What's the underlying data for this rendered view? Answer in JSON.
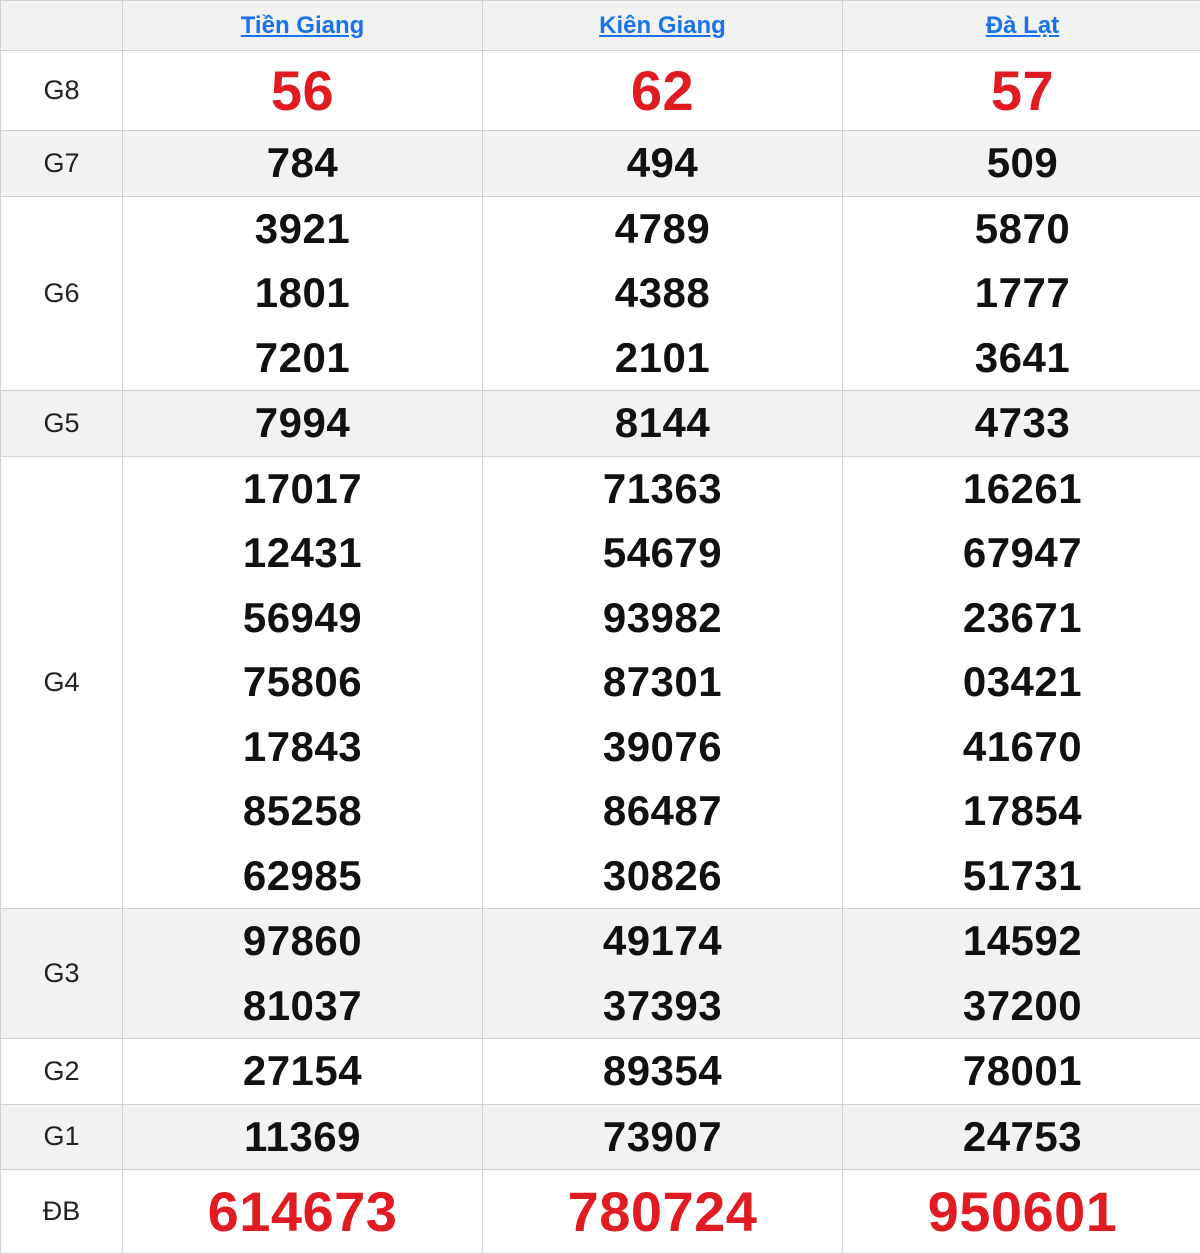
{
  "columns": [
    "Tiền Giang",
    "Kiên Giang",
    "Đà Lạt"
  ],
  "prizes": [
    {
      "label": "G8",
      "values": [
        [
          "56"
        ],
        [
          "62"
        ],
        [
          "57"
        ]
      ]
    },
    {
      "label": "G7",
      "values": [
        [
          "784"
        ],
        [
          "494"
        ],
        [
          "509"
        ]
      ]
    },
    {
      "label": "G6",
      "values": [
        [
          "3921",
          "1801",
          "7201"
        ],
        [
          "4789",
          "4388",
          "2101"
        ],
        [
          "5870",
          "1777",
          "3641"
        ]
      ]
    },
    {
      "label": "G5",
      "values": [
        [
          "7994"
        ],
        [
          "8144"
        ],
        [
          "4733"
        ]
      ]
    },
    {
      "label": "G4",
      "values": [
        [
          "17017",
          "12431",
          "56949",
          "75806",
          "17843",
          "85258",
          "62985"
        ],
        [
          "71363",
          "54679",
          "93982",
          "87301",
          "39076",
          "86487",
          "30826"
        ],
        [
          "16261",
          "67947",
          "23671",
          "03421",
          "41670",
          "17854",
          "51731"
        ]
      ]
    },
    {
      "label": "G3",
      "values": [
        [
          "97860",
          "81037"
        ],
        [
          "49174",
          "37393"
        ],
        [
          "14592",
          "37200"
        ]
      ]
    },
    {
      "label": "G2",
      "values": [
        [
          "27154"
        ],
        [
          "89354"
        ],
        [
          "78001"
        ]
      ]
    },
    {
      "label": "G1",
      "values": [
        [
          "11369"
        ],
        [
          "73907"
        ],
        [
          "24753"
        ]
      ]
    },
    {
      "label": "ĐB",
      "values": [
        [
          "614673"
        ],
        [
          "780724"
        ],
        [
          "950601"
        ]
      ]
    }
  ],
  "colors": {
    "accent_red": "#e01b22",
    "link_blue": "#1a73e8",
    "row_shade": "#f2f2f2",
    "border": "#d0d0d0"
  }
}
